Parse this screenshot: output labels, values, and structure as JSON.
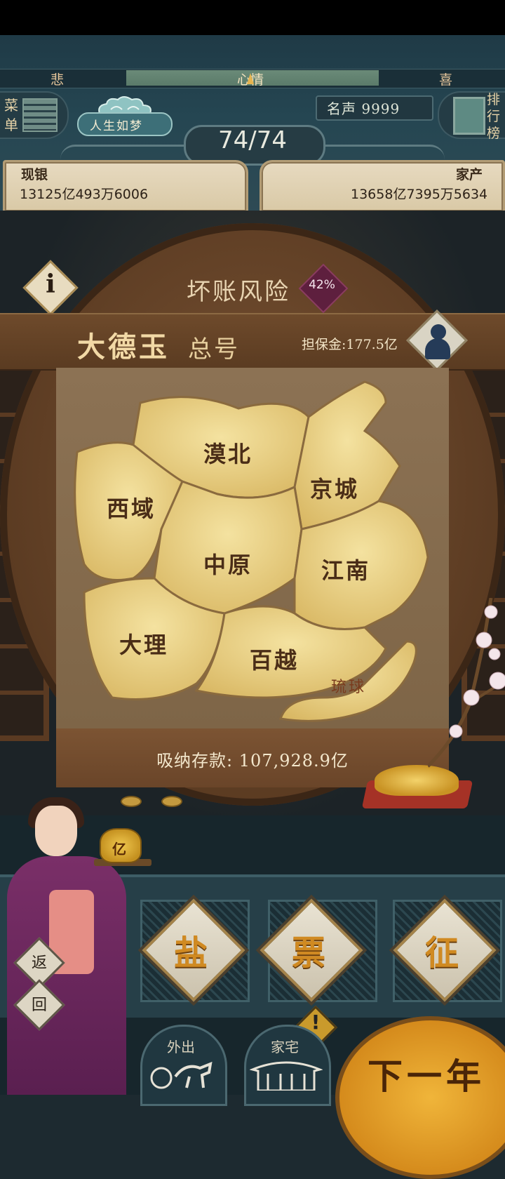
{
  "mood": {
    "sad_label": "悲",
    "title": "心情",
    "joy_label": "喜"
  },
  "menu": {
    "label": "菜单"
  },
  "rank": {
    "label": "排行榜"
  },
  "fame": {
    "text": "名声 9999"
  },
  "slogan": "人生如梦",
  "hp": {
    "text": "74/74"
  },
  "money": {
    "cash_label": "现银",
    "cash_value": "13125亿493万6006",
    "assets_label": "家产",
    "assets_value": "13658亿7395万5634"
  },
  "bank": {
    "risk_label": "坏账风险",
    "risk_value": "42%",
    "name": "大德玉",
    "sub": "总号",
    "collateral": "担保金:177.5亿",
    "deposit": "吸纳存款: 107,928.9亿",
    "info_glyph": "i"
  },
  "map": {
    "regions": [
      "漠北",
      "西域",
      "京城",
      "中原",
      "江南",
      "大理",
      "百越",
      "琉球"
    ]
  },
  "actions": {
    "salt": "盐",
    "ticket": "票",
    "levy": "征",
    "alert": "!"
  },
  "nav": {
    "outing": "外出",
    "home": "家宅",
    "next_year": "下一年"
  },
  "back": {
    "top": "返",
    "bottom": "回"
  },
  "bag": "亿"
}
